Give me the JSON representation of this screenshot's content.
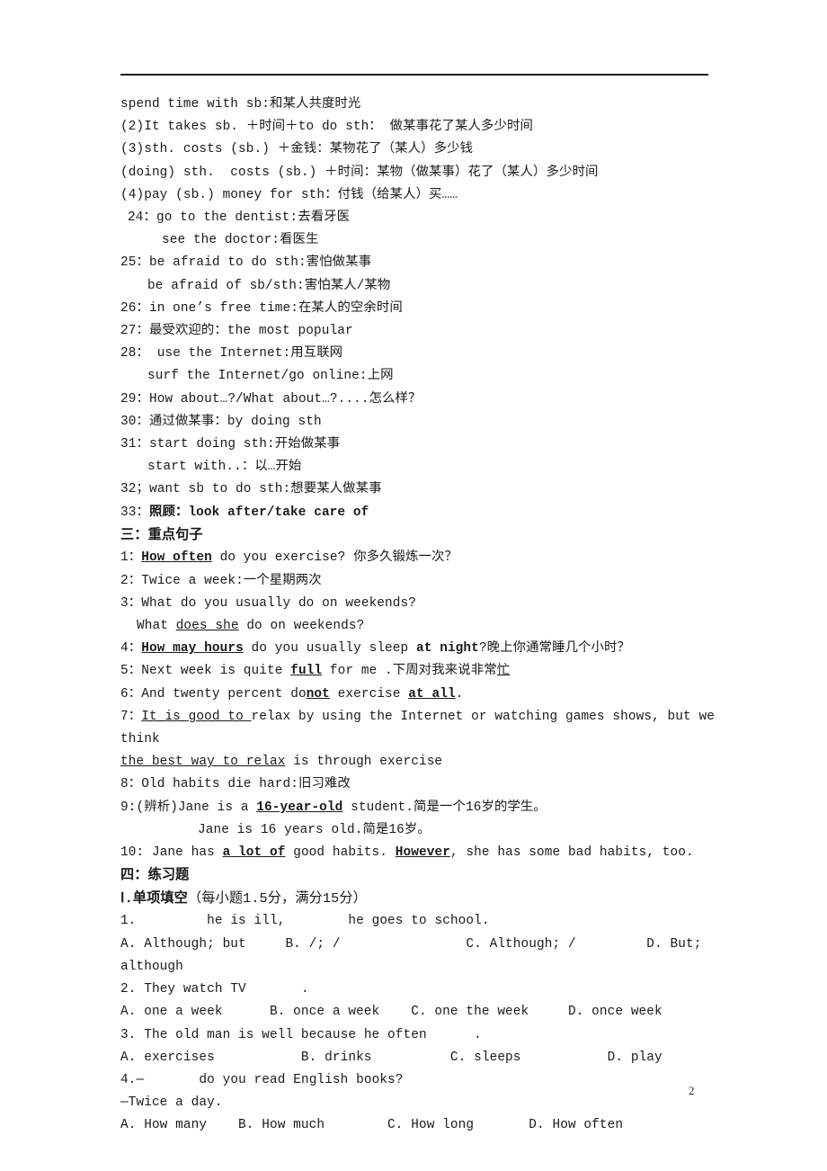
{
  "document": {
    "page_number": "2",
    "header_rule": true
  },
  "phrases": {
    "lines": [
      {
        "id": "spend-time",
        "indent": "i0",
        "text": "spend time with sb:和某人共度时光"
      },
      {
        "id": "it-takes",
        "indent": "i0",
        "text": "(2)It takes sb. ＋时间＋to do sth： 做某事花了某人多少时间"
      },
      {
        "id": "sth-costs-money",
        "indent": "i0",
        "text": "(3)sth. costs (sb.) ＋金钱：某物花了（某人）多少钱"
      },
      {
        "id": "doing-sth-costs",
        "indent": "i0",
        "text": "(doing) sth.  costs (sb.) ＋时间：某物（做某事）花了（某人）多少时间"
      },
      {
        "id": "pay-money-for",
        "indent": "i0",
        "text": "(4)pay (sb.) money for sth：付钱（给某人）买……"
      },
      {
        "id": "item-24",
        "indent": "i1",
        "text": "24：go to the dentist:去看牙医"
      },
      {
        "id": "item-24b",
        "indent": "i4",
        "text": "see the doctor:看医生"
      },
      {
        "id": "item-25",
        "indent": "i0",
        "text": "25：be afraid to do sth:害怕做某事"
      },
      {
        "id": "item-25b",
        "indent": "i3",
        "text": "be afraid of sb/sth:害怕某人/某物"
      },
      {
        "id": "item-26",
        "indent": "i0",
        "text": "26：in one’s free time:在某人的空余时间"
      },
      {
        "id": "item-27",
        "indent": "i0",
        "text": "27：最受欢迎的：the most popular"
      },
      {
        "id": "item-28",
        "indent": "i0",
        "text": "28： use the Internet:用互联网"
      },
      {
        "id": "item-28b",
        "indent": "i3",
        "text": "surf the Internet/go online:上网"
      },
      {
        "id": "item-29",
        "indent": "i0",
        "text": "29：How about…?/What about…?....怎么样？"
      },
      {
        "id": "item-30",
        "indent": "i0",
        "text": "30：通过做某事：by doing sth"
      },
      {
        "id": "item-31",
        "indent": "i0",
        "text": "31：start doing sth:开始做某事"
      },
      {
        "id": "item-31b",
        "indent": "i3",
        "text": "start with..：以…开始"
      },
      {
        "id": "item-32",
        "indent": "i0",
        "text": "32；want sb to do sth:想要某人做某事"
      }
    ],
    "item_33": {
      "indent": "i0",
      "number": "33：",
      "bold_part": "照顾：look after/take care of"
    }
  },
  "section_three": {
    "heading": "三：重点句子",
    "sentences": {
      "s1": {
        "num": "1：",
        "emph": "How often",
        "rest": " do you exercise? 你多久锻炼一次？"
      },
      "s2": {
        "num": "2：",
        "text": "Twice a week:一个星期两次"
      },
      "s3a": {
        "num": "3：",
        "text": "What do you usually do on weekends?"
      },
      "s3b": {
        "pre": "What ",
        "emph": "does she",
        "rest": " do on weekends?"
      },
      "s4": {
        "num": "4：",
        "emph": "How may hours",
        "mid": " do you usually sleep ",
        "emph2": "at night",
        "rest": "?晚上你通常睡几个小时？"
      },
      "s5": {
        "num": "5：",
        "pre": "Next week is quite ",
        "emph": "full",
        "mid": " for me .下周对我来说非常",
        "emph2": "忙"
      },
      "s6": {
        "num": "6：",
        "pre": "And twenty percent do",
        "emph": "not",
        "mid": " exercise ",
        "emph2": "at all",
        "rest": "."
      },
      "s7a": {
        "num": "7：",
        "emph": "It is good to ",
        "rest": "relax by using the Internet or watching games shows, but we think"
      },
      "s7b": {
        "emph": "the best way to relax",
        "rest": " is through exercise"
      },
      "s8": {
        "num": "8：",
        "text": "Old habits die hard:旧习难改"
      },
      "s9a": {
        "num": "9:",
        "pre": "(辨析)Jane is a ",
        "emph": "16-year-old",
        "rest": " student.简是一个16岁的学生。"
      },
      "s9b": {
        "text": "Jane is 16 years old.简是16岁。"
      },
      "s10": {
        "num": "10: ",
        "pre": "Jane has ",
        "emph": "a lot of",
        "mid": " good habits. ",
        "emph2": "However",
        "rest": ", she has some bad habits, too."
      }
    }
  },
  "section_four": {
    "heading": "四：练习题",
    "subheading_bold": "Ⅰ.单项填空",
    "subheading_regular": "（每小题1.5分，满分15分）",
    "questions": [
      {
        "id": "q1",
        "stem_parts": {
          "num": "1.",
          "blank1": "________",
          "mid": " he is ill, ",
          "blank2": "_______",
          "tail": "he goes to school."
        },
        "options": "A. Although; but     B. /; /                C. Although; /         D. But; although"
      },
      {
        "id": "q2",
        "stem_parts": {
          "num": "2. ",
          "mid": "They watch TV",
          "blank1": "_______",
          "tail": "."
        },
        "options": "A. one a week      B. once a week    C. one the week     D. once week"
      },
      {
        "id": "q3",
        "stem_parts": {
          "num": "3. ",
          "mid": "The old man is well because he often",
          "blank1": "______",
          "tail": "."
        },
        "options": "A. exercises           B. drinks          C. sleeps           D. play"
      },
      {
        "id": "q4",
        "stem_parts": {
          "num": "4.",
          "mid": "—",
          "blank1": "_______",
          "tail": "do you read English books?"
        },
        "answer_line": "—Twice a day.",
        "options": "A. How many    B. How much        C. How long       D. How often"
      }
    ]
  }
}
